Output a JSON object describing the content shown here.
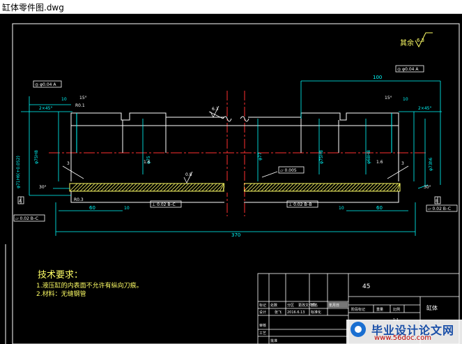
{
  "window": {
    "title": "缸体零件图.dwg"
  },
  "drawing": {
    "roughness_note": "其余",
    "roughness_default": "6.3",
    "dims": {
      "overall_length": "370",
      "left_len": "60",
      "right_len": "60",
      "top_len": "100",
      "dia_left_outer": "φ71H6(+0.052)",
      "dia_left_seal": "φ75H8",
      "dia_mid": "φ75",
      "dia_center": "φ77",
      "dia_right_seal": "φ75H8",
      "dia_right_bore": "φ68H8",
      "dia_right_outer": "φ73h6",
      "chamfer_left": "2×45°",
      "chamfer_right": "2×45°",
      "len10_a": "10",
      "len10_b": "10",
      "r03": "R0.3",
      "r1": "R0.1",
      "deg1": "15°",
      "deg2": "15°",
      "angle_left": "30°",
      "angle_right": "30°",
      "dim3a": "3",
      "dim3b": "3",
      "dim10c": "10",
      "dim10d": "10",
      "rough_a": "6.3",
      "rough_b": "0.8",
      "rough_c": "1.6",
      "rough_d": "1.6"
    },
    "tolerances": {
      "top_left": "◎ φ0.04 A",
      "top_right": "◎ φ0.04 A",
      "mid_flat": "▱ 0.005",
      "bottom_left": "⊥ 0.02 B–C",
      "bottom_right": "⊥ 0.02 B–B",
      "frame_left": "▱ 0.02 B–C",
      "frame_right": "▱ 0.02 B–C"
    },
    "datums": {
      "left": "A",
      "right": "B"
    }
  },
  "notes": {
    "heading": "技术要求：",
    "line1": "1.液压缸的内表面不允许有纵向刀痕。",
    "line2": "2.材料：无缝钢管"
  },
  "title_block": {
    "part_name": "缸体",
    "material": "45",
    "row_labels": [
      "标记",
      "处数",
      "分区",
      "更改文件号",
      "签名",
      "年月日"
    ],
    "design_row": [
      "设计",
      "张飞",
      "2016.6.13",
      "标准化"
    ],
    "review_label": "审核",
    "process_label": "工艺",
    "approve_label": "批准",
    "stage_label": "阶段标记",
    "weight_label": "重量",
    "scale_label": "比例",
    "scale_value": "1:1"
  },
  "watermark": {
    "title": "毕业设计论文网",
    "url": "www.56doc.com"
  }
}
